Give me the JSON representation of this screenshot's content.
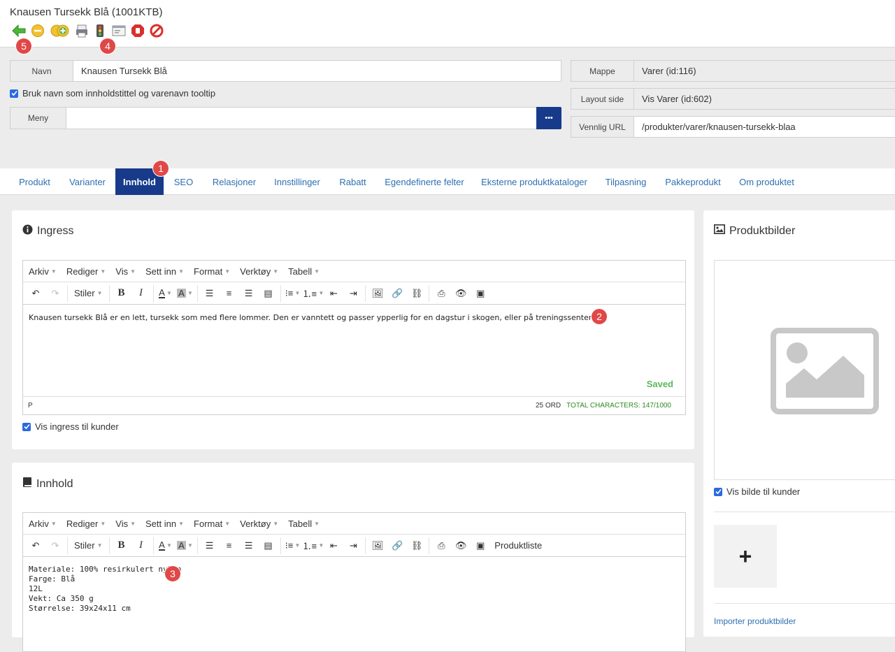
{
  "window": {
    "title": "Knausen Tursekk Blå (1001KTB)"
  },
  "toolbar": {
    "icons": [
      "back-icon",
      "minus-icon",
      "add-icon",
      "print-icon",
      "traffic-light-icon",
      "preview-icon",
      "stop-icon",
      "cancel-icon"
    ]
  },
  "badges": {
    "b1": "1",
    "b2": "2",
    "b3": "3",
    "b4": "4",
    "b5": "5"
  },
  "form": {
    "navn_label": "Navn",
    "navn_value": "Knausen Tursekk Blå",
    "use_name_checkbox": "Bruk navn som innholdstittel og varenavn tooltip",
    "meny_label": "Meny",
    "meny_value": "",
    "more_button": "•••",
    "mappe_label": "Mappe",
    "mappe_value": "Varer (id:116)",
    "layout_label": "Layout side",
    "layout_value": "Vis Varer (id:602)",
    "url_label": "Vennlig URL",
    "url_value": "/produkter/varer/knausen-tursekk-blaa"
  },
  "tabs": [
    "Produkt",
    "Varianter",
    "Innhold",
    "SEO",
    "Relasjoner",
    "Innstillinger",
    "Rabatt",
    "Egendefinerte felter",
    "Eksterne produktkataloger",
    "Tilpasning",
    "Pakkeprodukt",
    "Om produktet"
  ],
  "active_tab": "Innhold",
  "ingress": {
    "title": "Ingress",
    "menu": [
      "Arkiv",
      "Rediger",
      "Vis",
      "Sett inn",
      "Format",
      "Verktøy",
      "Tabell"
    ],
    "styles_label": "Stiler",
    "text": "Knausen tursekk Blå er en lett, tursekk som med flere lommer. Den er vanntett og passer ypperlig for en dagstur i skogen, eller på treningssenter.",
    "saved": "Saved",
    "path": "P",
    "word_count": "25 ORD",
    "char_count": "TOTAL CHARACTERS: 147/1000",
    "show_checkbox": "Vis ingress til kunder"
  },
  "innhold": {
    "title": "Innhold",
    "menu": [
      "Arkiv",
      "Rediger",
      "Vis",
      "Sett inn",
      "Format",
      "Verktøy",
      "Tabell"
    ],
    "styles_label": "Stiler",
    "product_list_button": "Produktliste",
    "lines": [
      "Materiale: 100% resirkulert nylon",
      "Farge: Blå",
      "12L",
      "Vekt: Ca 350 g",
      "Størrelse: 39x24x11 cm"
    ]
  },
  "produktbilder": {
    "title": "Produktbilder",
    "show_checkbox": "Vis bilde til kunder",
    "add_button": "+",
    "import_link": "Importer produktbilder"
  },
  "colors": {
    "accent": "#173a8a",
    "link": "#2d70b0",
    "badge": "#e04848",
    "saved": "#5cb85c"
  }
}
